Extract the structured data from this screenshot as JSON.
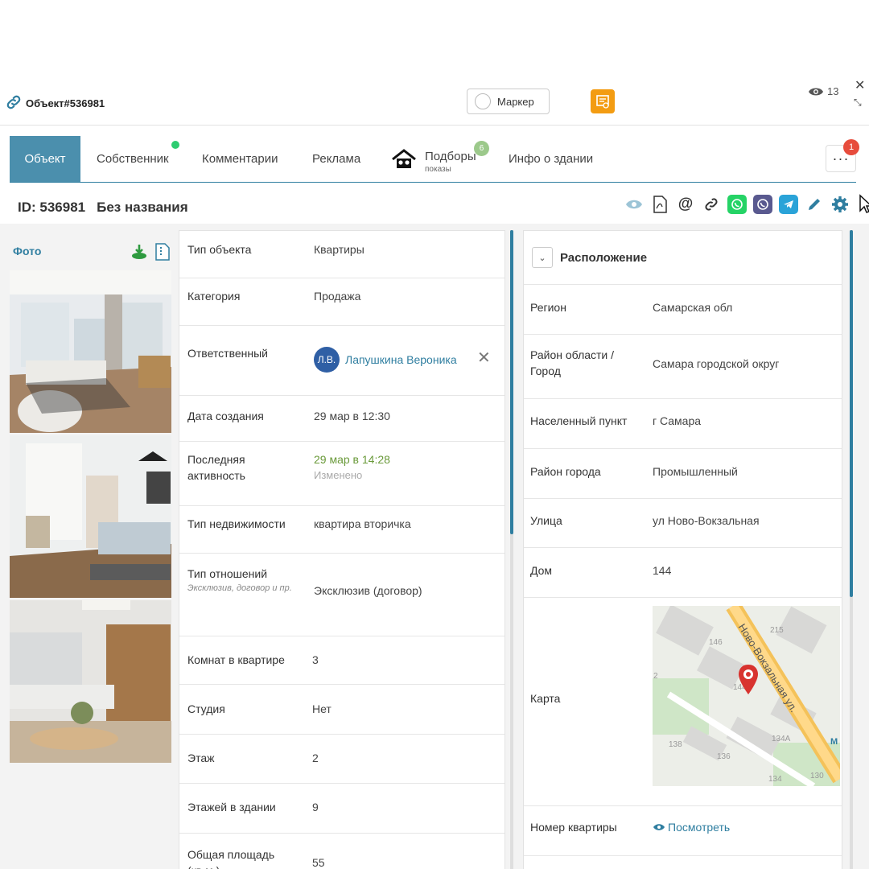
{
  "topbar": {
    "object_title": "Объект#536981",
    "marker_label": "Маркер",
    "views_count": "13",
    "close_glyph": "✕",
    "expand_glyph": "⤡"
  },
  "tabs": [
    {
      "label": "Объект"
    },
    {
      "label": "Собственник"
    },
    {
      "label": "Комментарии"
    },
    {
      "label": "Реклама"
    },
    {
      "label": "Подборы",
      "sub": "показы",
      "badge": "6"
    },
    {
      "label": "Инфо о здании"
    }
  ],
  "more": {
    "label": "···",
    "badge": "1"
  },
  "header": {
    "id_label": "ID: 536981",
    "name": "Без названия"
  },
  "photos": {
    "label": "Фото"
  },
  "main_rows": [
    {
      "label": "Тип объекта",
      "value": "Квартиры"
    },
    {
      "label": "Категория",
      "value": "Продажа"
    },
    {
      "label": "Ответственный",
      "avatar": "Л.В.",
      "value": "Лапушкина Вероника"
    },
    {
      "label": "Дата создания",
      "value": "29 мар в 12:30"
    },
    {
      "label": "Последняя активность",
      "value": "29 мар в 14:28",
      "sub": "Изменено"
    },
    {
      "label": "Тип недвижимости",
      "value": "квартира вторичка"
    },
    {
      "label": "Тип отношений",
      "hint": "Эксклюзив, договор и пр.",
      "value": "Эксклюзив (договор)"
    },
    {
      "label": "Комнат в квартире",
      "value": "3"
    },
    {
      "label": "Студия",
      "value": "Нет"
    },
    {
      "label": "Этаж",
      "value": "2"
    },
    {
      "label": "Этажей в здании",
      "value": "9"
    },
    {
      "label": "Общая площадь (кв.м.)",
      "value": "55"
    }
  ],
  "location": {
    "title": "Расположение",
    "rows": [
      {
        "label": "Регион",
        "value": "Самарская обл"
      },
      {
        "label": "Район области / Город",
        "value": "Самара городской округ"
      },
      {
        "label": "Населенный пункт",
        "value": "г Самара"
      },
      {
        "label": "Район города",
        "value": "Промышленный"
      },
      {
        "label": "Улица",
        "value": "ул Ново-Вокзальная"
      },
      {
        "label": "Дом",
        "value": "144"
      },
      {
        "label": "Карта"
      },
      {
        "label": "Номер квартиры",
        "value": "Посмотреть"
      }
    ],
    "map": {
      "street": "Ново-Вокзальная ул.",
      "numbers": [
        "215",
        "146",
        "144",
        "138",
        "136",
        "134А",
        "134",
        "130",
        "2",
        "М"
      ]
    }
  },
  "colors": {
    "accent": "#2f7ea0",
    "tab_active": "#4b8fad",
    "badge_red": "#e74c3c",
    "online_green": "#2ecc71",
    "orange": "#f39c12"
  }
}
